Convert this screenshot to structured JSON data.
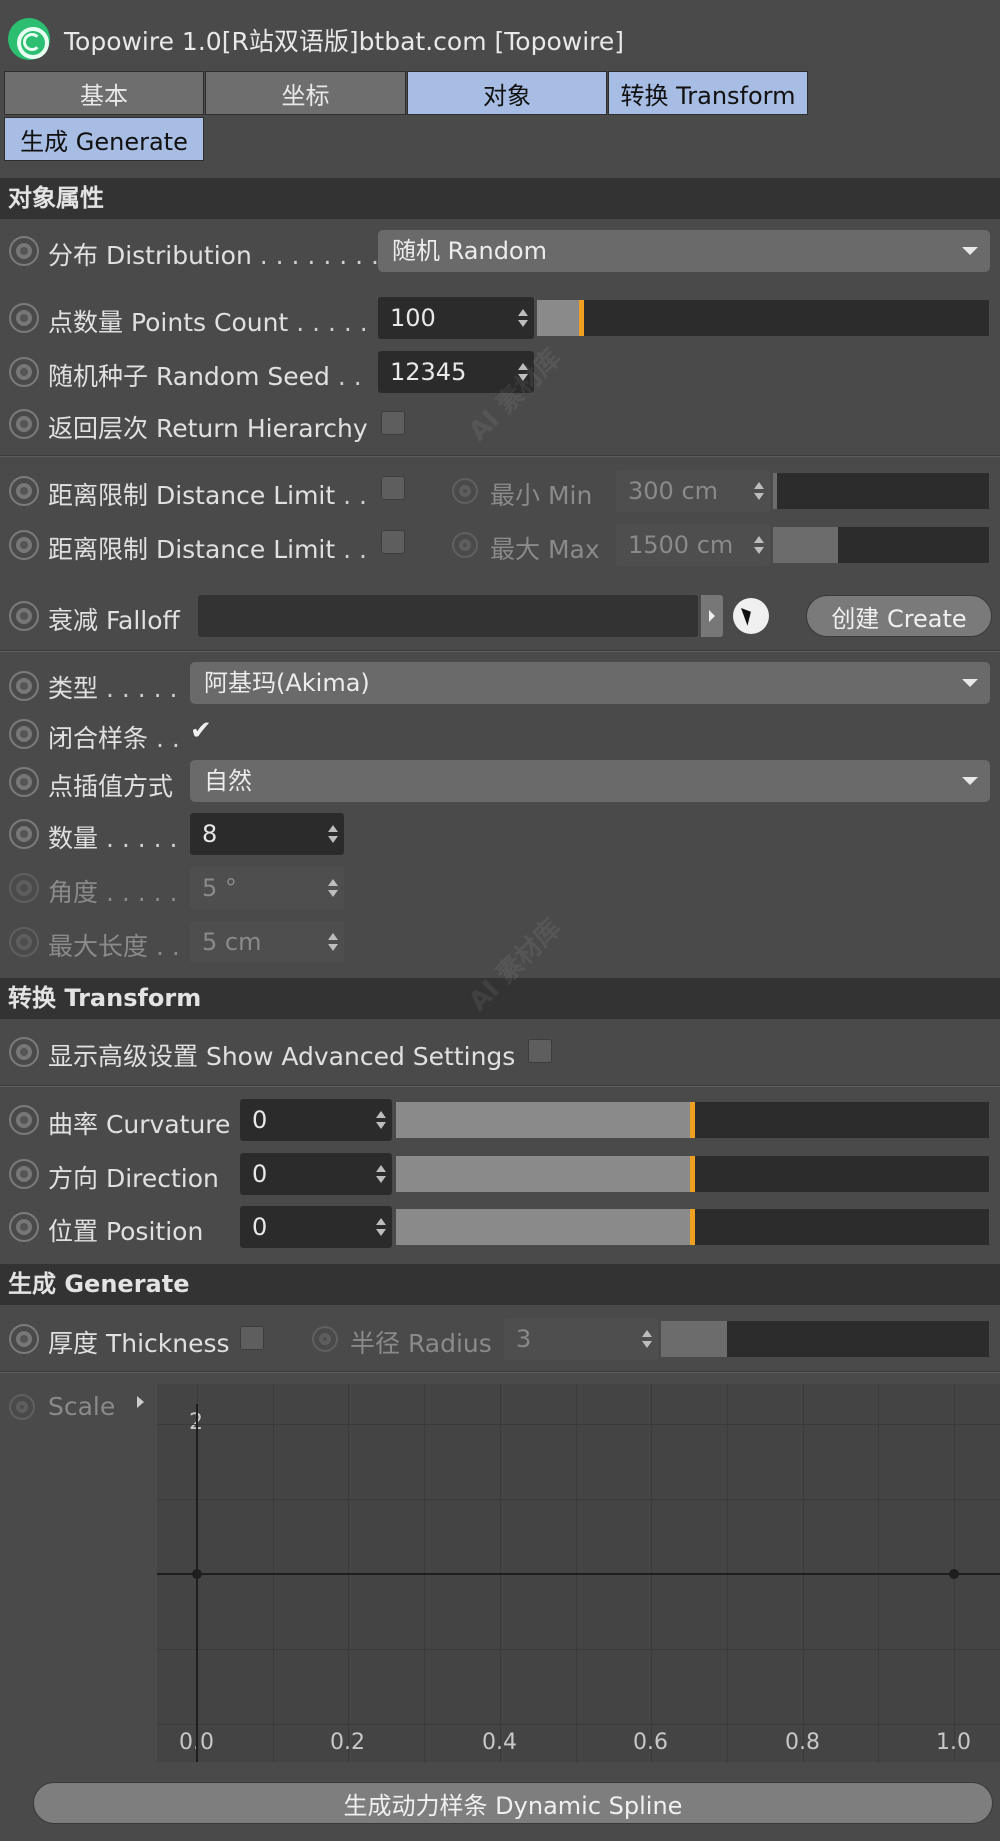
{
  "window": {
    "title": "Topowire 1.0[R站双语版]btbat.com [Topowire]"
  },
  "tabs": [
    {
      "label": "基本",
      "active": false
    },
    {
      "label": "坐标",
      "active": false
    },
    {
      "label": "对象",
      "active": true
    },
    {
      "label": "转换 Transform",
      "active": true
    },
    {
      "label": "生成 Generate",
      "active": true
    }
  ],
  "object_props": {
    "header": "对象属性",
    "distribution": {
      "label": "分布 Distribution",
      "dots": ". . . . . . . .",
      "value": "随机 Random"
    },
    "points_count": {
      "label": "点数量 Points Count",
      "dots": ". . . . .",
      "value": "100",
      "fill": 0.1
    },
    "random_seed": {
      "label": "随机种子 Random Seed",
      "dots": ". .",
      "value": "12345"
    },
    "return_hierarchy": {
      "label": "返回层次 Return Hierarchy",
      "checked": false
    },
    "distance_min": {
      "label": "距离限制 Distance Limit",
      "dots": ". .",
      "checked": false,
      "sub_label": "最小 Min",
      "value": "300 cm",
      "fill": 0.02
    },
    "distance_max": {
      "label": "距离限制 Distance Limit",
      "dots": ". .",
      "checked": false,
      "sub_label": "最大 Max",
      "value": "1500 cm",
      "fill": 0.3
    },
    "falloff": {
      "label": "衰减 Falloff",
      "value": "",
      "create_label": "创建 Create"
    },
    "type": {
      "label": "类型",
      "dots": ". . . . .",
      "value": "阿基玛(Akima)"
    },
    "close_spline": {
      "label": "闭合样条",
      "dots": ". .",
      "checked": true
    },
    "interpolation": {
      "label": "点插值方式",
      "value": "自然"
    },
    "count": {
      "label": "数量",
      "dots": ". . . . .",
      "value": "8"
    },
    "angle": {
      "label": "角度",
      "dots": ". . . . .",
      "value": "5 °"
    },
    "max_length": {
      "label": "最大长度",
      "dots": ". .",
      "value": "5 cm"
    }
  },
  "transform": {
    "header": "转换 Transform",
    "show_advanced": {
      "label": "显示高级设置 Show Advanced Settings",
      "checked": false
    },
    "curvature": {
      "label": "曲率 Curvature",
      "value": "0",
      "fill": 0.5
    },
    "direction": {
      "label": "方向 Direction",
      "value": "0",
      "fill": 0.5
    },
    "position": {
      "label": "位置 Position",
      "value": "0",
      "fill": 0.5
    }
  },
  "generate": {
    "header": "生成 Generate",
    "thickness": {
      "label": "厚度 Thickness",
      "checked": false
    },
    "radius": {
      "label": "半径 Radius",
      "value": "3",
      "fill": 0.2
    },
    "scale": {
      "label": "Scale"
    }
  },
  "graph": {
    "y_tick": "2",
    "x_ticks": [
      "0.0",
      "0.2",
      "0.4",
      "0.6",
      "0.8",
      "1.0"
    ],
    "points": [
      [
        0.0,
        1.0
      ],
      [
        1.0,
        1.0
      ]
    ]
  },
  "footer": {
    "button_label": "生成动力样条 Dynamic Spline"
  },
  "watermark": "AI 素材库",
  "colors": {
    "accent": "#f0a020",
    "active_tab": "#a7bde3",
    "logo": "#2cbf72"
  }
}
